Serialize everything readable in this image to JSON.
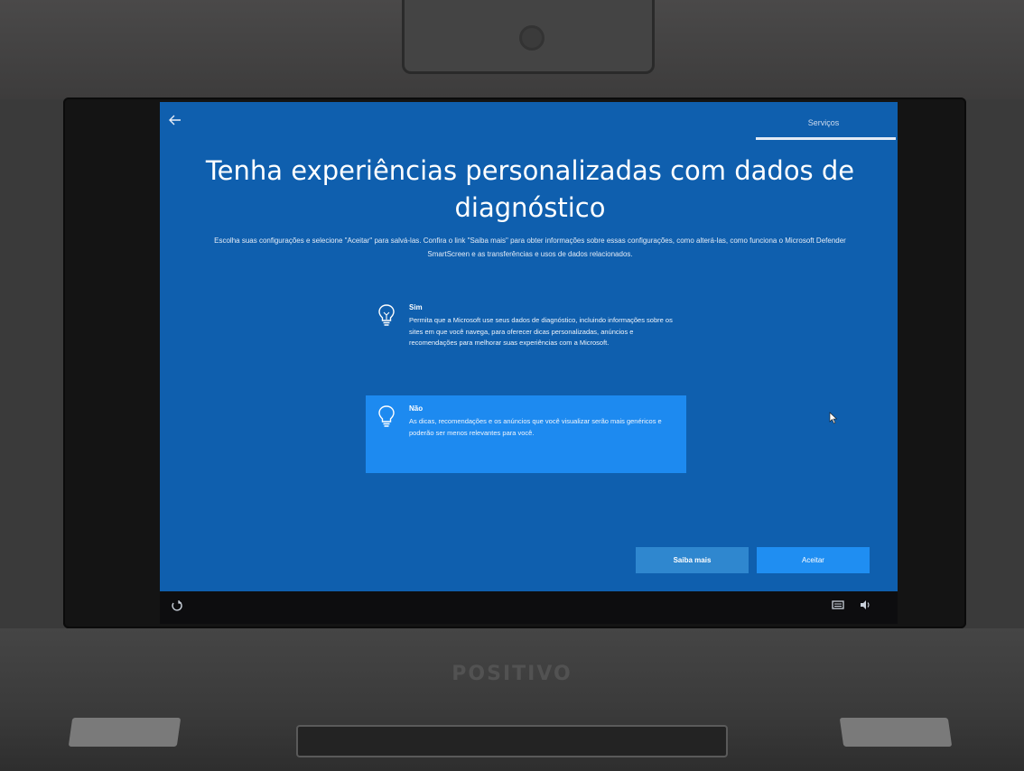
{
  "device": {
    "brand": "POSITIVO"
  },
  "oobe": {
    "back_icon": "arrow-left-icon",
    "stage_label": "Serviços",
    "title": "Tenha experiências personalizadas com dados de diagnóstico",
    "subtitle": "Escolha suas configurações e selecione \"Aceitar\" para salvá-las. Confira o link \"Saiba mais\" para obter informações sobre essas configurações, como alterá-las, como funciona o Microsoft Defender SmartScreen e as transferências e usos de dados relacionados.",
    "options": [
      {
        "icon": "lightbulb-on-icon",
        "title": "Sim",
        "description": "Permita que a Microsoft use seus dados de diagnóstico, incluindo informações sobre os sites em que você navega, para oferecer dicas personalizadas, anúncios e recomendações para melhorar suas experiências com a Microsoft.",
        "selected": false
      },
      {
        "icon": "lightbulb-off-icon",
        "title": "Não",
        "description": "As dicas, recomendações e os anúncios que você visualizar serão mais genéricos e poderão ser menos relevantes para você.",
        "selected": true
      }
    ],
    "buttons": {
      "learn_more": "Saiba mais",
      "accept": "Aceitar"
    }
  },
  "taskbar": {
    "left_icon": "accessibility-icon",
    "right_icons": [
      "keyboard-icon",
      "volume-icon"
    ]
  },
  "colors": {
    "screen_bg": "#0f5fae",
    "selected_option": "#1d8af0",
    "accent_button": "#1f8ef2"
  }
}
